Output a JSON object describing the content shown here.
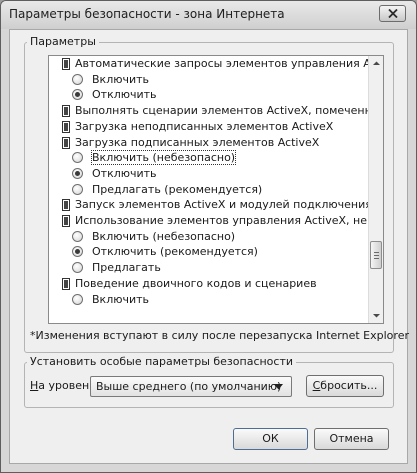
{
  "window": {
    "title": "Параметры безопасности - зона Интернета"
  },
  "settings_group": {
    "label": "Параметры",
    "items": [
      {
        "kind": "category",
        "text": "Автоматические запросы элементов управления ActiveX"
      },
      {
        "kind": "option",
        "text": "Включить",
        "checked": false
      },
      {
        "kind": "option",
        "text": "Отключить",
        "checked": true
      },
      {
        "kind": "category",
        "text": "Выполнять сценарии элементов ActiveX, помеченных как"
      },
      {
        "kind": "category",
        "text": "Загрузка неподписанных элементов ActiveX"
      },
      {
        "kind": "category",
        "text": "Загрузка подписанных элементов ActiveX"
      },
      {
        "kind": "option",
        "text": "Включить (небезопасно)",
        "checked": false,
        "focused": true
      },
      {
        "kind": "option",
        "text": "Отключить",
        "checked": true
      },
      {
        "kind": "option",
        "text": "Предлагать (рекомендуется)",
        "checked": false
      },
      {
        "kind": "category",
        "text": "Запуск элементов ActiveX и модулей подключения"
      },
      {
        "kind": "category",
        "text": "Использование элементов управления ActiveX, не помече"
      },
      {
        "kind": "option",
        "text": "Включить (небезопасно)",
        "checked": false
      },
      {
        "kind": "option",
        "text": "Отключить (рекомендуется)",
        "checked": true
      },
      {
        "kind": "option",
        "text": "Предлагать",
        "checked": false
      },
      {
        "kind": "category",
        "text": "Поведение двоичного кодов и сценариев"
      },
      {
        "kind": "option",
        "text": "Включить",
        "checked": false
      }
    ],
    "note": "*Изменения вступают в силу после перезапуска Internet Explorer"
  },
  "reset_group": {
    "label": "Установить особые параметры безопасности",
    "level_label_accel": "Н",
    "level_label_rest": "а уровень:",
    "level_value": "Выше среднего (по умолчанию)",
    "reset_button_accel": "С",
    "reset_button_rest": "бросить..."
  },
  "buttons": {
    "ok": "ОК",
    "cancel": "Отмена"
  },
  "icons": {
    "close": "close-icon",
    "category": "settings-category-icon",
    "radio": "radio-button",
    "dropdown": "chevron-down-icon",
    "scroll_up": "arrow-up-icon",
    "scroll_down": "arrow-down-icon"
  }
}
